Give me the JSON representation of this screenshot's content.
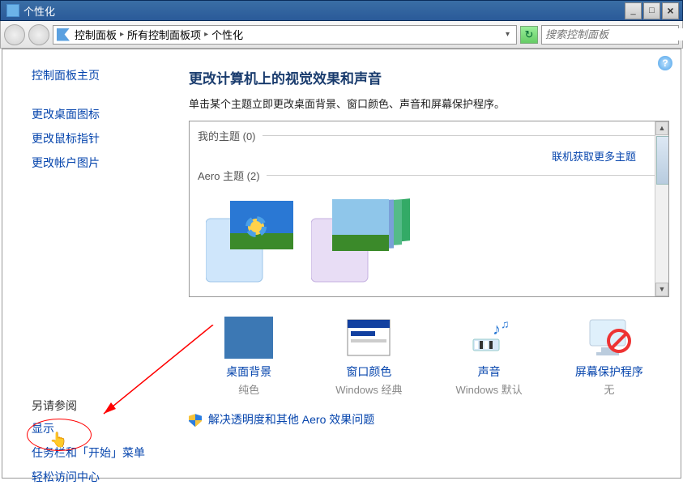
{
  "window": {
    "title": "个性化"
  },
  "toolbar": {
    "crumb1": "控制面板",
    "crumb2": "所有控制面板项",
    "crumb3": "个性化",
    "search_placeholder": "搜索控制面板"
  },
  "sidebar": {
    "home": "控制面板主页",
    "links": [
      "更改桌面图标",
      "更改鼠标指针",
      "更改帐户图片"
    ],
    "see_also_heading": "另请参阅",
    "see_also": [
      "显示",
      "任务栏和「开始」菜单",
      "轻松访问中心"
    ]
  },
  "main": {
    "title": "更改计算机上的视觉效果和声音",
    "subtitle": "单击某个主题立即更改桌面背景、窗口颜色、声音和屏幕保护程序。",
    "group_my": "我的主题 (0)",
    "more_themes": "联机获取更多主题",
    "group_aero": "Aero 主题 (2)"
  },
  "bottom": {
    "items": [
      {
        "label": "桌面背景",
        "sub": "纯色"
      },
      {
        "label": "窗口颜色",
        "sub": "Windows 经典"
      },
      {
        "label": "声音",
        "sub": "Windows 默认"
      },
      {
        "label": "屏幕保护程序",
        "sub": "无"
      }
    ],
    "aero_link": "解决透明度和其他 Aero 效果问题"
  }
}
